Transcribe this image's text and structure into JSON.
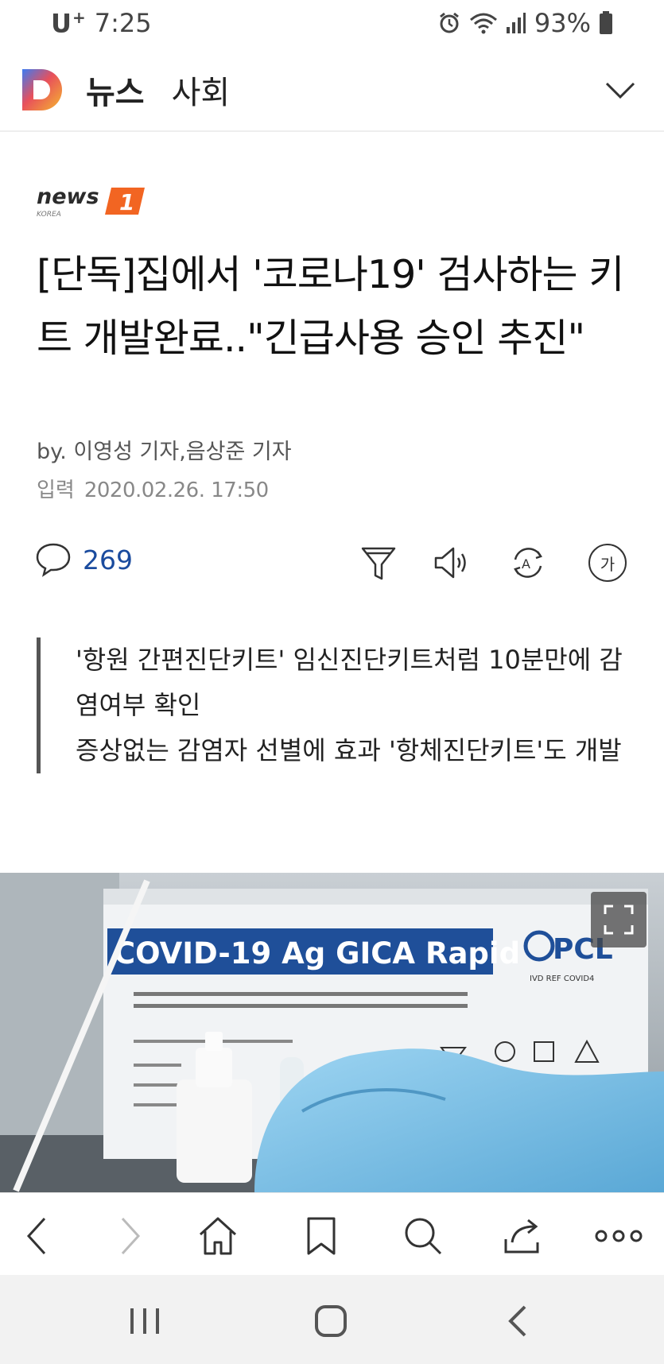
{
  "status_bar": {
    "carrier": "U",
    "carrier_plus": "+",
    "time": "7:25",
    "battery": "93%"
  },
  "header": {
    "title": "뉴스",
    "section": "사회"
  },
  "article": {
    "press": "news1 KOREA",
    "headline": "[단독]집에서 '코로나19' 검사하는 키트 개발완료..\"긴급사용 승인 추진\"",
    "byline": "by. 이영성 기자,음상준 기자",
    "date_label": "입력",
    "date_value": "2020.02.26. 17:50",
    "comment_count": "269",
    "summary_lines": [
      "'항원 간편진단키트' 임신진단키트처럼 10분만에 감염여부 확인",
      "증상없는 감염자 선별에 효과 '항체진단키트'도 개발"
    ],
    "font_size_icon_label": "가"
  },
  "photo": {
    "box_title": "COVID-19 Ag GICA Rapid",
    "brand": "PCL",
    "box_codes": "IVD REF COVID4"
  },
  "colors": {
    "accent_blue": "#1a4b9e",
    "press_orange": "#f26522",
    "glove_blue": "#7ec3e8"
  }
}
